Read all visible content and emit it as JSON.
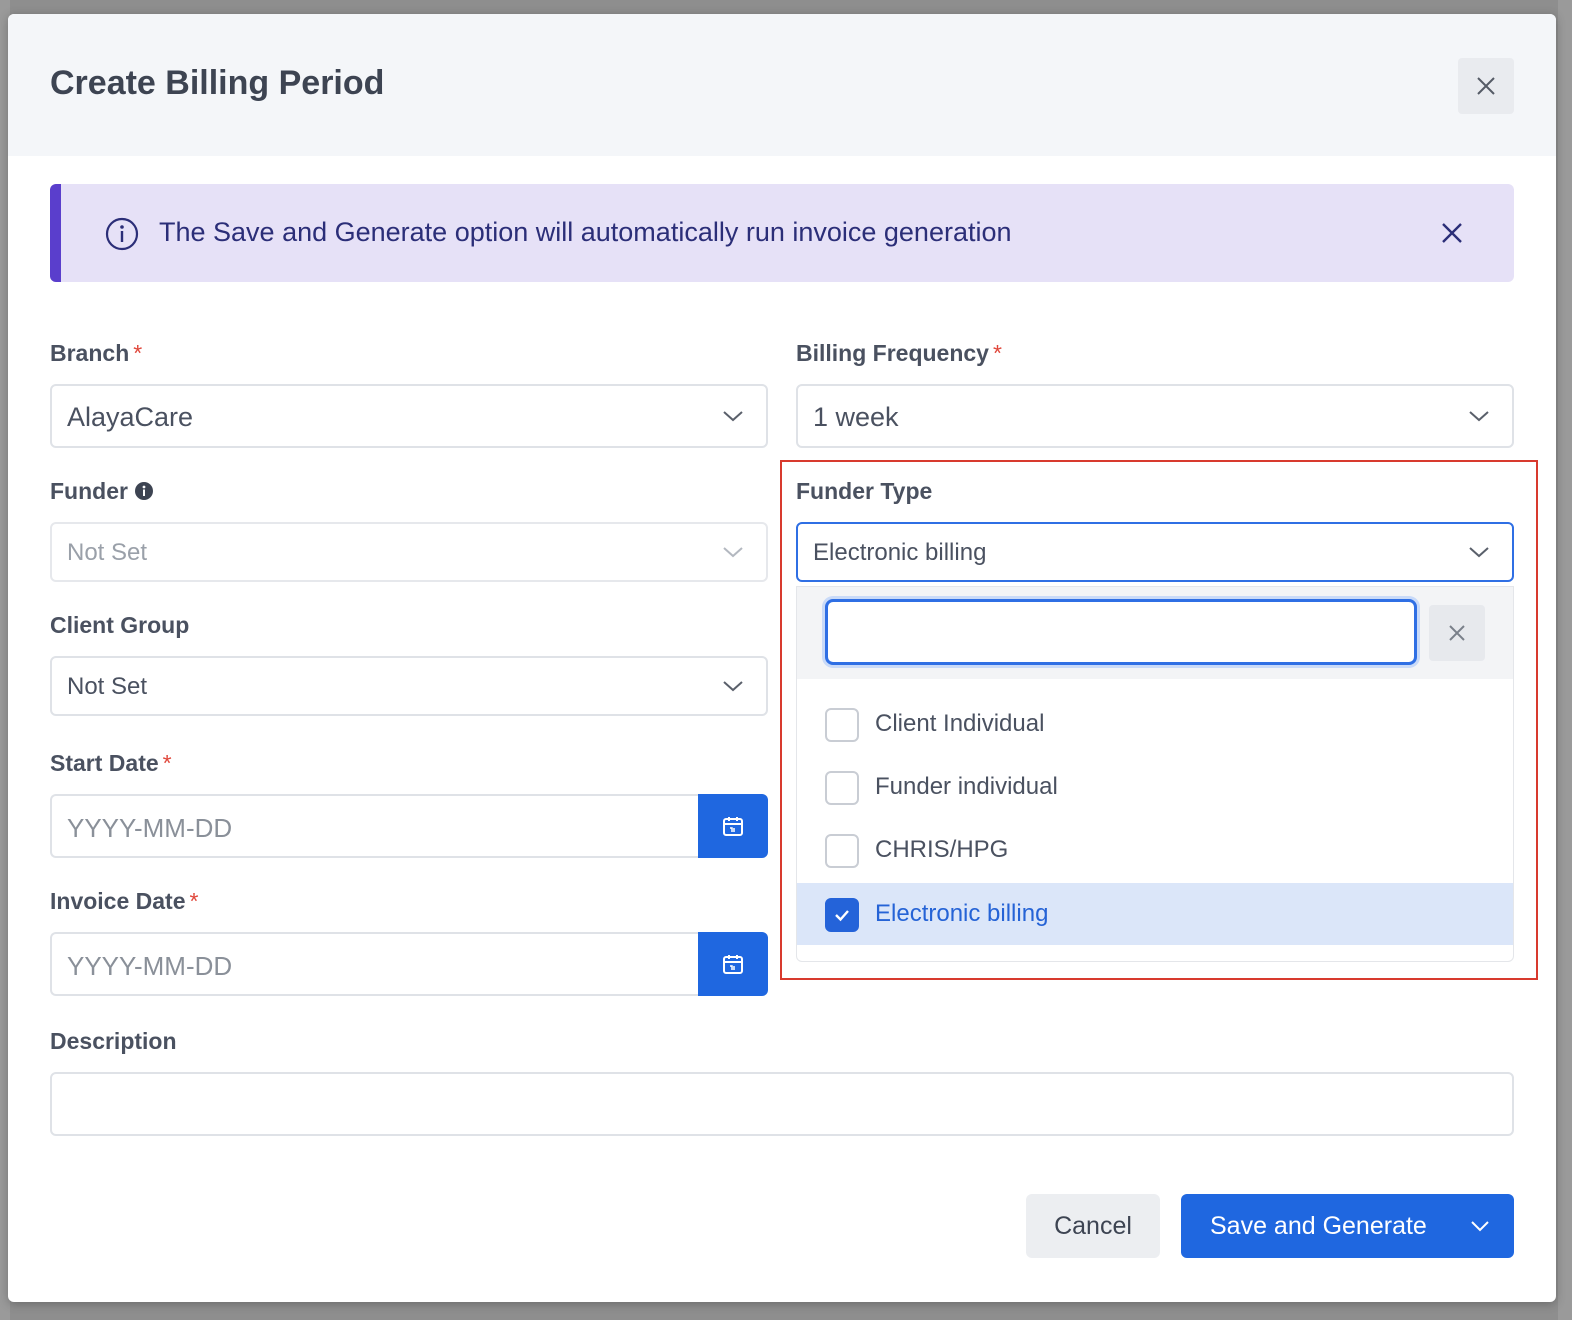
{
  "modal": {
    "title": "Create Billing Period"
  },
  "banner": {
    "message": "The Save and Generate option will automatically run invoice generation"
  },
  "fields": {
    "branch": {
      "label": "Branch",
      "required": "*",
      "value": "AlayaCare"
    },
    "billing_frequency": {
      "label": "Billing Frequency",
      "required": "*",
      "value": "1 week"
    },
    "funder": {
      "label": "Funder",
      "value": "Not Set"
    },
    "funder_type": {
      "label": "Funder Type",
      "value": "Electronic billing"
    },
    "client_group": {
      "label": "Client Group",
      "value": "Not Set"
    },
    "start_date": {
      "label": "Start Date",
      "required": "*",
      "placeholder": "YYYY-MM-DD"
    },
    "invoice_date": {
      "label": "Invoice Date",
      "required": "*",
      "placeholder": "YYYY-MM-DD"
    },
    "description": {
      "label": "Description",
      "value": ""
    }
  },
  "funder_type_dropdown": {
    "search_value": "",
    "options": [
      {
        "label": "Client Individual",
        "checked": false
      },
      {
        "label": "Funder individual",
        "checked": false
      },
      {
        "label": "CHRIS/HPG",
        "checked": false
      },
      {
        "label": "Electronic billing",
        "checked": true
      }
    ]
  },
  "buttons": {
    "cancel": "Cancel",
    "save_generate": "Save and Generate"
  },
  "colors": {
    "primary": "#1f67e0",
    "banner_bg": "#e6e1f7",
    "banner_accent": "#5a3ecc",
    "required": "#e0473b",
    "highlight": "#d83a2e",
    "selected_row": "#dbe6f9"
  },
  "icons": {
    "close": "close-icon",
    "info": "info-icon",
    "chevron": "chevron-down-icon",
    "calendar": "calendar-icon",
    "check": "check-icon"
  }
}
